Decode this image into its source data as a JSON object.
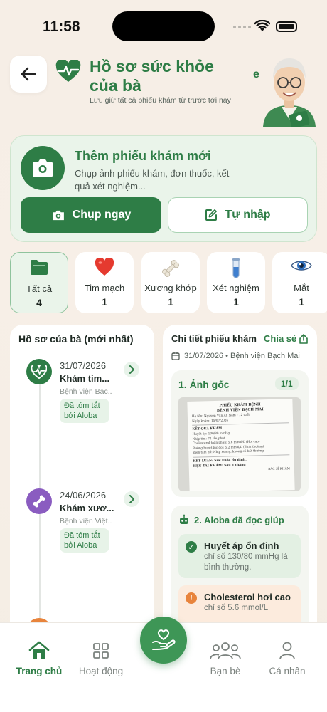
{
  "status_bar": {
    "time": "11:58"
  },
  "header": {
    "title": "Hồ sơ sức khỏe của bà",
    "subtitle": "Lưu giữ tất cả phiếu khám từ trước tới nay",
    "trailing_char": "e"
  },
  "add_card": {
    "title": "Thêm phiếu khám mới",
    "description": "Chụp ảnh phiếu khám, đơn thuốc, kết quả xét nghiệm...",
    "capture_label": "Chụp ngay",
    "manual_label": "Tự nhập"
  },
  "categories": [
    {
      "label": "Tất cả",
      "count": "4",
      "icon": "folder-icon",
      "active": true
    },
    {
      "label": "Tim mạch",
      "count": "1",
      "icon": "heart-icon"
    },
    {
      "label": "Xương khớp",
      "count": "1",
      "icon": "bone-icon"
    },
    {
      "label": "Xét nghiệm",
      "count": "1",
      "icon": "test-tube-icon"
    },
    {
      "label": "Mắt",
      "count": "1",
      "icon": "eye-icon"
    }
  ],
  "records": {
    "title": "Hồ sơ của bà (mới nhất)",
    "items": [
      {
        "date": "31/07/2026",
        "title": "Khám tim...",
        "hospital": "Bệnh viện Bạc...",
        "badge": "Đã tóm tắt bởi Aloba",
        "icon": "heart-pulse-icon",
        "color": "#2e7d46"
      },
      {
        "date": "24/06/2026",
        "title": "Khám xươ...",
        "hospital": "Bệnh viện Việt...",
        "badge": "Đã tóm tắt bởi Aloba",
        "icon": "bone-icon",
        "color": "#8a5cc0"
      }
    ]
  },
  "detail": {
    "title": "Chi tiết phiếu khám",
    "share_label": "Chia sẻ",
    "meta": "31/07/2026 • Bệnh viện Bạch Mai",
    "image_section": {
      "title": "1. Ảnh gốc",
      "pager": "1/1",
      "document": {
        "header1": "PHIẾU KHÁM BỆNH",
        "header2": "BỆNH VIỆN BẠCH MAI",
        "name_line": "Họ tên:   Nguyễn Văn An                Nam - 72 tuổi",
        "date_line": "Ngày khám:   15/07/2026",
        "results_title": "KẾT QUẢ KHÁM",
        "lines": [
          "Huyết áp:          130/80 mmHg",
          "Nhịp tim:           72 lần/phút",
          "Cholesterol toàn phần:   5.6 mmol/L (Hơi cao)",
          "Đường huyết lúc đói:     5.2 mmol/L (Bình thường)",
          "Điện tâm đồ:    Nhịp xoang, không có bất thường"
        ],
        "conclusion": "KẾT LUẬN:   Sức khỏe ổn định.",
        "followup": "HẸN TÁI KHÁM:   Sau 1 tháng",
        "signature": "BÁC SĨ KHÁM"
      }
    },
    "aloba_section": {
      "title": "2. Aloba đã đọc giúp",
      "findings": [
        {
          "head": "Huyết áp ổn định",
          "body": "chỉ số 130/80 mmHg là bình thường.",
          "status": "ok"
        },
        {
          "head": "Cholesterol hơi cao",
          "body": "chỉ số 5.6 mmol/L",
          "status": "warn"
        }
      ]
    }
  },
  "bottom_nav": [
    {
      "label": "Trang chủ",
      "icon": "home-icon",
      "active": true
    },
    {
      "label": "Hoạt động",
      "icon": "grid-icon"
    },
    {
      "label": "Bạn bè",
      "icon": "friends-icon"
    },
    {
      "label": "Cá nhân",
      "icon": "person-icon"
    }
  ],
  "colors": {
    "primary": "#2e7d46",
    "accent_light": "#eaf4ea",
    "warn_bg": "#fcebdd",
    "warn": "#e8843c"
  }
}
